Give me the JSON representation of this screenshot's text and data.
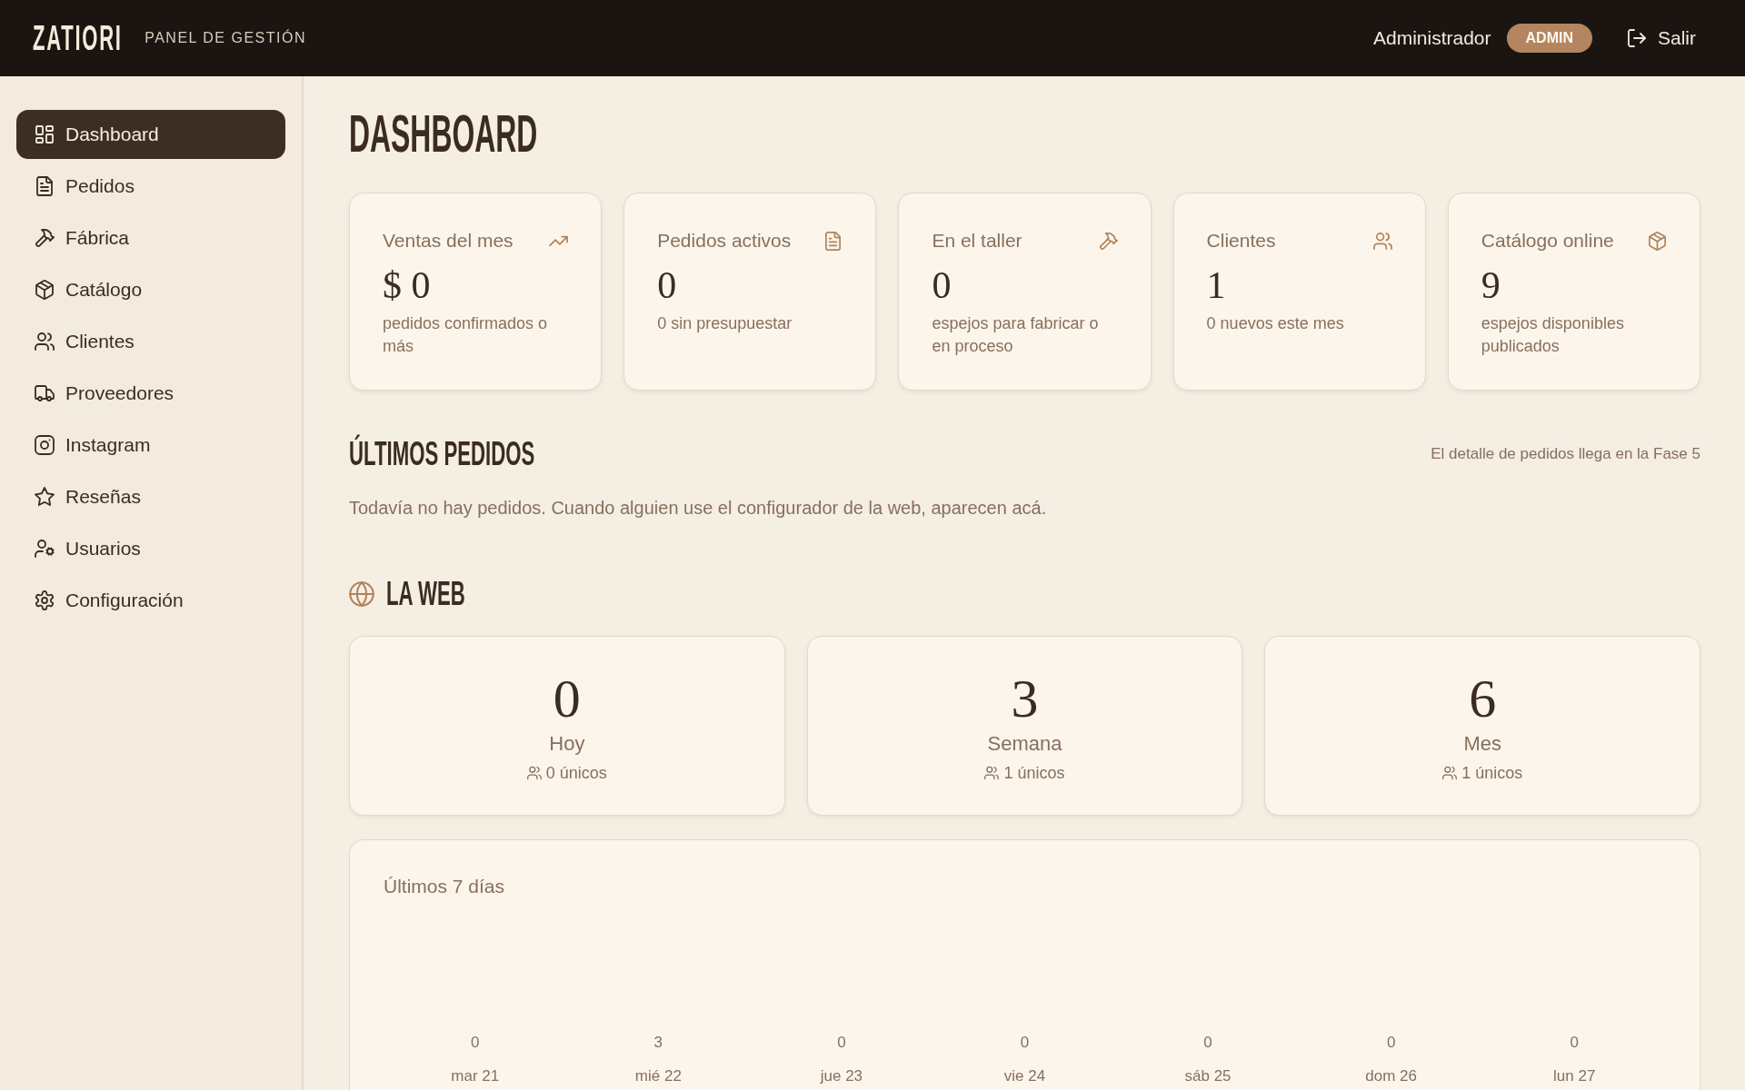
{
  "header": {
    "logo": "ZATIORI",
    "subtitle": "PANEL DE GESTIÓN",
    "user": "Administrador",
    "role": "ADMIN",
    "logout": "Salir"
  },
  "sidebar": {
    "items": [
      {
        "label": "Dashboard",
        "selected": true
      },
      {
        "label": "Pedidos",
        "selected": false
      },
      {
        "label": "Fábrica",
        "selected": false
      },
      {
        "label": "Catálogo",
        "selected": false
      },
      {
        "label": "Clientes",
        "selected": false
      },
      {
        "label": "Proveedores",
        "selected": false
      },
      {
        "label": "Instagram",
        "selected": false
      },
      {
        "label": "Reseñas",
        "selected": false
      },
      {
        "label": "Usuarios",
        "selected": false
      },
      {
        "label": "Configuración",
        "selected": false
      }
    ]
  },
  "page_title": "DASHBOARD",
  "stats": [
    {
      "title": "Ventas del mes",
      "value": "$ 0",
      "note": "pedidos confirmados o más"
    },
    {
      "title": "Pedidos activos",
      "value": "0",
      "note": "0 sin presupuestar"
    },
    {
      "title": "En el taller",
      "value": "0",
      "note": "espejos para fabricar o en proceso"
    },
    {
      "title": "Clientes",
      "value": "1",
      "note": "0 nuevos este mes"
    },
    {
      "title": "Catálogo online",
      "value": "9",
      "note": "espejos disponibles publicados"
    }
  ],
  "recent_orders": {
    "title": "ÚLTIMOS PEDIDOS",
    "note": "El detalle de pedidos llega en la Fase 5",
    "empty_message": "Todavía no hay pedidos. Cuando alguien use el configurador de la web, aparecen acá."
  },
  "web": {
    "title": "LA WEB",
    "periods": [
      {
        "value": "0",
        "label": "Hoy",
        "unique": "0 únicos"
      },
      {
        "value": "3",
        "label": "Semana",
        "unique": "1 únicos"
      },
      {
        "value": "6",
        "label": "Mes",
        "unique": "1 únicos"
      }
    ],
    "last_7_days": {
      "title": "Últimos 7 días",
      "days": [
        {
          "count": "0",
          "label": "mar 21"
        },
        {
          "count": "3",
          "label": "mié 22"
        },
        {
          "count": "0",
          "label": "jue 23"
        },
        {
          "count": "0",
          "label": "vie 24"
        },
        {
          "count": "0",
          "label": "sáb 25"
        },
        {
          "count": "0",
          "label": "dom 26"
        },
        {
          "count": "0",
          "label": "lun 27"
        }
      ]
    }
  }
}
